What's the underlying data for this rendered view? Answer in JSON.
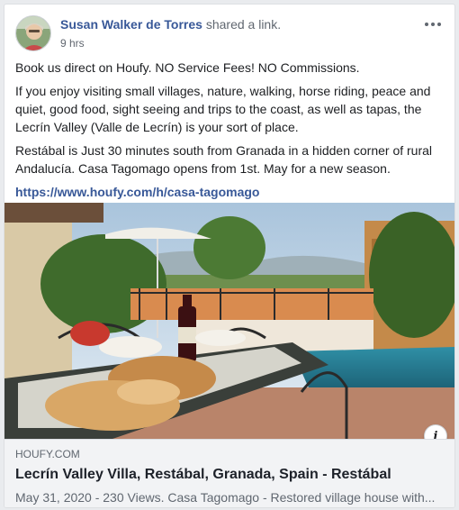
{
  "post": {
    "author": "Susan Walker de Torres",
    "action": "shared a link.",
    "time": "9 hrs",
    "paragraphs": [
      "Book us direct on Houfy. NO Service Fees! NO Commissions.",
      "If you enjoy visiting small villages, nature, walking, horse riding, peace and quiet, good food, sight seeing and trips to the coast, as well as tapas, the Lecrín Valley (Valle de Lecrín) is your sort of place.",
      "Restábal is Just 30 minutes south from Granada in a hidden corner of rural Andalucía. Casa Tagomago opens from 1st. May for a new season."
    ],
    "link": "https://www.houfy.com/h/casa-tagomago"
  },
  "preview": {
    "domain": "HOUFY.COM",
    "title": "Lecrín Valley Villa, Restábal, Granada, Spain - Restábal",
    "description": "May 31, 2020 - 230 Views. Casa Tagomago - Restored village house with...",
    "info_icon": "info-icon"
  },
  "icons": {
    "more": "more-options-icon",
    "avatar": "avatar"
  },
  "colors": {
    "link": "#385898",
    "meta_bg": "#f2f3f5",
    "text": "#1c1e21"
  }
}
